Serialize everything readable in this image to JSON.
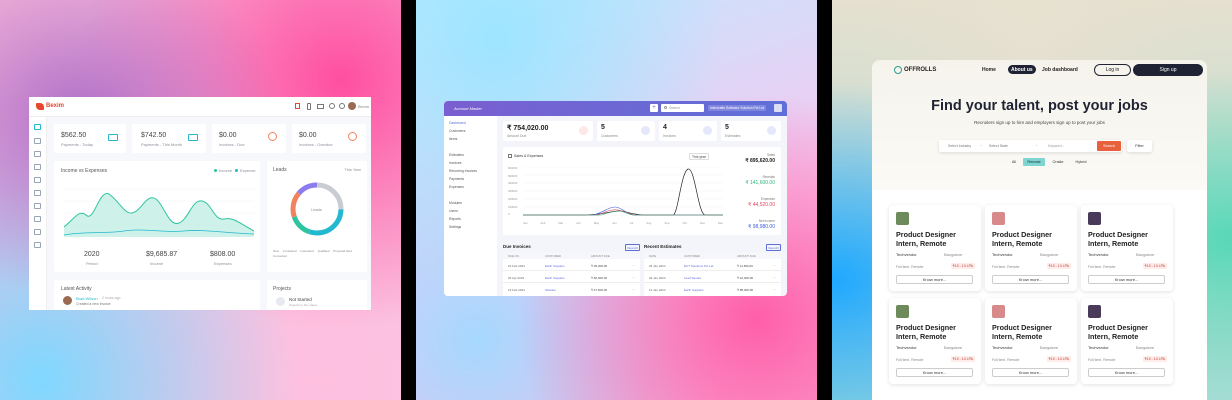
{
  "panel1": {
    "brand": "Bexim",
    "user_name": "Bexim",
    "stats": [
      {
        "value": "$562.50",
        "label": "Payments - Today",
        "color": "#22b8cf"
      },
      {
        "value": "$742.50",
        "label": "Payments - This Month",
        "color": "#22b8cf"
      },
      {
        "value": "$0.00",
        "label": "Invoices - Due",
        "color": "#f0825f"
      },
      {
        "value": "$0.00",
        "label": "Invoices - Overdue",
        "color": "#f0825f"
      }
    ],
    "income_chart": {
      "title": "Income vs Expenses",
      "legend": [
        "Income",
        "Expense"
      ],
      "summary": [
        {
          "value": "2020",
          "label": "Period"
        },
        {
          "value": "$9,685.87",
          "label": "Income"
        },
        {
          "value": "$808.00",
          "label": "Expenses"
        }
      ]
    },
    "leads": {
      "title": "Leads",
      "period": "This Year",
      "center": "Leads",
      "legend": [
        "New",
        "Contacted",
        "Interested",
        "Qualified",
        "Proposal Sent",
        "Converted"
      ]
    },
    "activity": {
      "title": "Latest Activity",
      "user": "Brad Wilson",
      "time": "2 hours ago",
      "text": "Created a new invoice"
    },
    "projects": {
      "title": "Projects",
      "status": "Not Started",
      "sub": "Projects in this status"
    }
  },
  "panel2": {
    "company": "Account Master",
    "search_placeholder": "Search",
    "org": "Intercrafts Software Solution Pvt Ltd",
    "nav": [
      "Dashboard",
      "Customers",
      "Items",
      "Estimates",
      "Invoices",
      "Recurring Invoices",
      "Payments",
      "Expenses",
      "Modules",
      "Users",
      "Reports",
      "Settings"
    ],
    "stats": [
      {
        "value": "₹ 754,020.00",
        "label": "Amount Due"
      },
      {
        "value": "5",
        "label": "Customers"
      },
      {
        "value": "4",
        "label": "Invoices"
      },
      {
        "value": "5",
        "label": "Estimates"
      }
    ],
    "chart_title": "Sales & Expenses",
    "chart_period": "This year",
    "right_values": [
      {
        "label": "Sales",
        "value": "₹ 895,620.00",
        "color": "#222"
      },
      {
        "label": "Receipts",
        "value": "₹ 141,600.00",
        "color": "#2eb67d"
      },
      {
        "label": "Expenses",
        "value": "₹ 44,520.00",
        "color": "#e0465e"
      },
      {
        "label": "Net Income",
        "value": "₹ 98,980.00",
        "color": "#3b5bdb"
      }
    ],
    "y_ticks": [
      "600000",
      "500000",
      "400000",
      "300000",
      "200000",
      "100000",
      "0"
    ],
    "months": [
      "Jan",
      "Feb",
      "Mar",
      "Apr",
      "May",
      "Jun",
      "Jul",
      "Aug",
      "Sep",
      "Oct",
      "Nov",
      "Dec"
    ],
    "due_invoices": {
      "title": "Due Invoices",
      "view_all": "View All",
      "columns": [
        "DUE ON",
        "CUSTOMER",
        "AMOUNT DUE"
      ],
      "rows": [
        [
          "22 Feb 2024",
          "Earth Supplies",
          "₹ 35,000.00"
        ],
        [
          "25 Apr 2024",
          "Earth Supplies",
          "₹ 82,000.00"
        ],
        [
          "19 Feb 2024",
          "Sheldoo",
          "₹ 47,500.00"
        ]
      ]
    },
    "recent_estimates": {
      "title": "Recent Estimates",
      "view_all": "View All",
      "columns": [
        "DATE",
        "CUSTOMER",
        "AMOUNT DUE"
      ],
      "rows": [
        [
          "25 Jan 2024",
          "ECT Solutions Pvt Ltd",
          "₹ 11,500.00"
        ],
        [
          "03 Jan 2024",
          "Lead Square",
          "₹ 42,000.00"
        ],
        [
          "12 Jan 2024",
          "Earth Supplies",
          "₹ 88,000.00"
        ]
      ]
    }
  },
  "panel3": {
    "brand": "OFFROLLS",
    "nav": [
      "Home",
      "About us",
      "Job dashboard"
    ],
    "login": "Log in",
    "signup": "Sign up",
    "hero_title": "Find your talent, post your jobs",
    "hero_sub": "Recruiters sign up to hire and employers sign up to post your jobs",
    "search": {
      "industry": "Select Industry",
      "state": "Select State",
      "keyword": "Keyword...",
      "button": "Search",
      "filter": "Filter"
    },
    "chips": [
      "All",
      "Remote",
      "Onsite",
      "Hybrid"
    ],
    "jobs": [
      {
        "title": "Product Designer Intern, Remote",
        "company": "Techvendor",
        "location": "Bangalore",
        "type": "Full time, Remote",
        "pay": "₹10 - 14 LPA",
        "button": "Know more...",
        "color": "#6c8a5a"
      },
      {
        "title": "Product Designer Intern, Remote",
        "company": "Techvendor",
        "location": "Bangalore",
        "type": "Full time, Remote",
        "pay": "₹10 - 14 LPA",
        "button": "Know more...",
        "color": "#d88a8a"
      },
      {
        "title": "Product Designer Intern, Remote",
        "company": "Techvendor",
        "location": "Bangalore",
        "type": "Full time, Remote",
        "pay": "₹10 - 14 LPA",
        "button": "Know more...",
        "color": "#4a3a5a"
      },
      {
        "title": "Product Designer Intern, Remote",
        "company": "Techvendor",
        "location": "Bangalore",
        "type": "Full time, Remote",
        "pay": "₹10 - 14 LPA",
        "button": "Know more...",
        "color": "#6c8a5a"
      },
      {
        "title": "Product Designer Intern, Remote",
        "company": "Techvendor",
        "location": "Bangalore",
        "type": "Full time, Remote",
        "pay": "₹10 - 14 LPA",
        "button": "Know more...",
        "color": "#d88a8a"
      },
      {
        "title": "Product Designer Intern, Remote",
        "company": "Techvendor",
        "location": "Bangalore",
        "type": "Full time, Remote",
        "pay": "₹10 - 14 LPA",
        "button": "Know more...",
        "color": "#4a3a5a"
      }
    ]
  }
}
